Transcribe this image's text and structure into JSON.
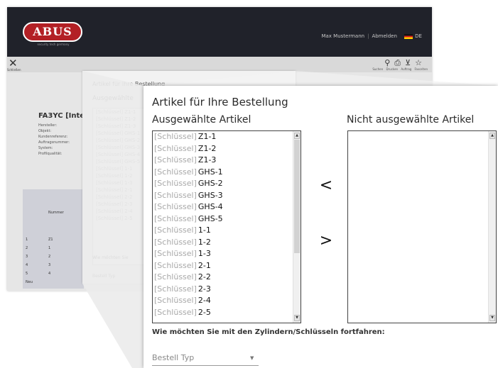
{
  "app": {
    "logo": "ABUS",
    "logo_tagline": "security tech germany",
    "user_name": "Max Mustermann",
    "logout": "Abmelden",
    "language": "DE"
  },
  "toolbar": {
    "close_label": "Schließen",
    "actions": [
      "Suchen",
      "Drucken",
      "Auftrag",
      "Favoriten"
    ]
  },
  "background": {
    "title": "FA3YC [Intern",
    "labels": [
      "Hersteller:",
      "Objekt:",
      "Kundenreferenz:",
      "Auftragsnummer:",
      "System:",
      "Profilqualität:"
    ],
    "table_header": "Nummer",
    "table_rows": [
      {
        "num": "1",
        "val": "Z1"
      },
      {
        "num": "2",
        "val": "1"
      },
      {
        "num": "3",
        "val": "2"
      },
      {
        "num": "4",
        "val": "3"
      },
      {
        "num": "5",
        "val": "4"
      }
    ],
    "table_footer": "Neu"
  },
  "middle_panel": {
    "title": "Artikel für Ihre Bestellung",
    "subtitle": "Ausgewählte",
    "question_prefix": "Wie möchten Sie",
    "order_type": "Bestell Typ"
  },
  "dialog": {
    "title": "Artikel für Ihre Bestellung",
    "selected_heading": "Ausgewählte Artikel",
    "unselected_heading": "Nicht ausgewählte Artikel",
    "move_left_label": "<",
    "move_right_label": ">",
    "selected_items": [
      {
        "kind": "[Schlüssel]",
        "code": "Z1-1"
      },
      {
        "kind": "[Schlüssel]",
        "code": "Z1-2"
      },
      {
        "kind": "[Schlüssel]",
        "code": "Z1-3"
      },
      {
        "kind": "[Schlüssel]",
        "code": "GHS-1"
      },
      {
        "kind": "[Schlüssel]",
        "code": "GHS-2"
      },
      {
        "kind": "[Schlüssel]",
        "code": "GHS-3"
      },
      {
        "kind": "[Schlüssel]",
        "code": "GHS-4"
      },
      {
        "kind": "[Schlüssel]",
        "code": "GHS-5"
      },
      {
        "kind": "[Schlüssel]",
        "code": "1-1"
      },
      {
        "kind": "[Schlüssel]",
        "code": "1-2"
      },
      {
        "kind": "[Schlüssel]",
        "code": "1-3"
      },
      {
        "kind": "[Schlüssel]",
        "code": "2-1"
      },
      {
        "kind": "[Schlüssel]",
        "code": "2-2"
      },
      {
        "kind": "[Schlüssel]",
        "code": "2-3"
      },
      {
        "kind": "[Schlüssel]",
        "code": "2-4"
      },
      {
        "kind": "[Schlüssel]",
        "code": "2-5"
      }
    ],
    "unselected_items": [],
    "question": "Wie möchten Sie mit den Zylindern/Schlüsseln fortfahren:",
    "order_type_placeholder": "Bestell Typ",
    "dropdown_arrow": "▼"
  }
}
